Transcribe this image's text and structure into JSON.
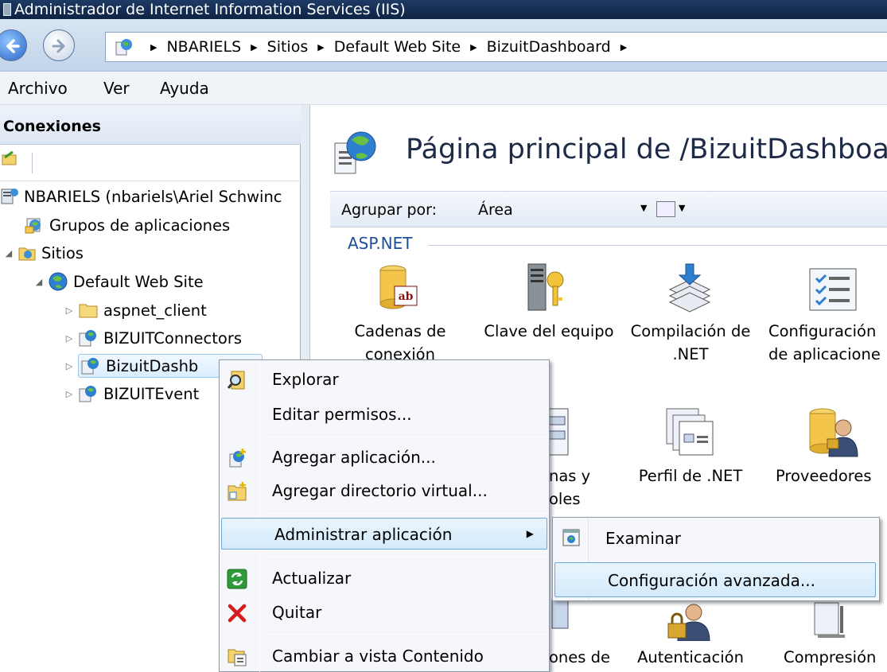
{
  "window": {
    "title": "Administrador de Internet Information Services (IIS)"
  },
  "address": {
    "crumbs": [
      "NBARIELS",
      "Sitios",
      "Default Web Site",
      "BizuitDashboard"
    ]
  },
  "menubar": {
    "items": [
      "Archivo",
      "Ver",
      "Ayuda"
    ]
  },
  "connections": {
    "header": "Conexiones",
    "tree": [
      {
        "label": "NBARIELS (nbariels\\Ariel Schwinc",
        "icon": "server-icon"
      },
      {
        "label": "Grupos de aplicaciones",
        "icon": "app-pool-icon"
      },
      {
        "label": "Sitios",
        "icon": "sites-folder-icon"
      },
      {
        "label": "Default Web Site",
        "icon": "globe-icon"
      },
      {
        "label": "aspnet_client",
        "icon": "folder-icon"
      },
      {
        "label": "BIZUITConnectors",
        "icon": "web-app-icon"
      },
      {
        "label": "BizuitDashb",
        "icon": "web-app-icon"
      },
      {
        "label": "BIZUITEvent",
        "icon": "web-app-icon"
      }
    ]
  },
  "main": {
    "title": "Página principal de /BizuitDashboarc",
    "group_by_label": "Agrupar por:",
    "group_by_value": "Área",
    "section": "ASP.NET",
    "features_row1": [
      {
        "line1": "Cadenas de",
        "line2": "conexión",
        "icon": "connection-strings-icon"
      },
      {
        "line1": "Clave del equipo",
        "line2": "",
        "icon": "machine-key-icon"
      },
      {
        "line1": "Compilación de",
        "line2": ".NET",
        "icon": "compilation-icon"
      },
      {
        "line1": "Configuración",
        "line2": "de aplicacione",
        "icon": "app-settings-icon"
      }
    ],
    "features_row2": [
      {
        "line1": "nas y",
        "line2": "oles",
        "icon": "pages-controls-icon"
      },
      {
        "line1": "Perfil de .NET",
        "line2": "",
        "icon": "profile-icon"
      },
      {
        "line1": "Proveedores",
        "line2": "",
        "icon": "providers-icon"
      }
    ],
    "features_row3": [
      {
        "line1": "ones de",
        "icon": ""
      },
      {
        "line1": "Autenticación",
        "icon": "authentication-icon"
      },
      {
        "line1": "Compresión",
        "icon": "compression-icon"
      }
    ]
  },
  "context_menu": {
    "items": [
      {
        "label": "Explorar",
        "icon": "explore-icon"
      },
      {
        "label": "Editar permisos...",
        "icon": ""
      },
      {
        "label": "Agregar aplicación...",
        "icon": "add-application-icon"
      },
      {
        "label": "Agregar directorio virtual...",
        "icon": "add-virtual-directory-icon"
      },
      {
        "label": "Administrar aplicación",
        "icon": ""
      },
      {
        "label": "Actualizar",
        "icon": "refresh-icon"
      },
      {
        "label": "Quitar",
        "icon": "remove-icon"
      },
      {
        "label": "Cambiar a vista Contenido",
        "icon": "content-view-icon"
      }
    ]
  },
  "submenu": {
    "items": [
      {
        "label": "Examinar",
        "icon": "browse-icon"
      },
      {
        "label": "Configuración avanzada..."
      }
    ]
  }
}
